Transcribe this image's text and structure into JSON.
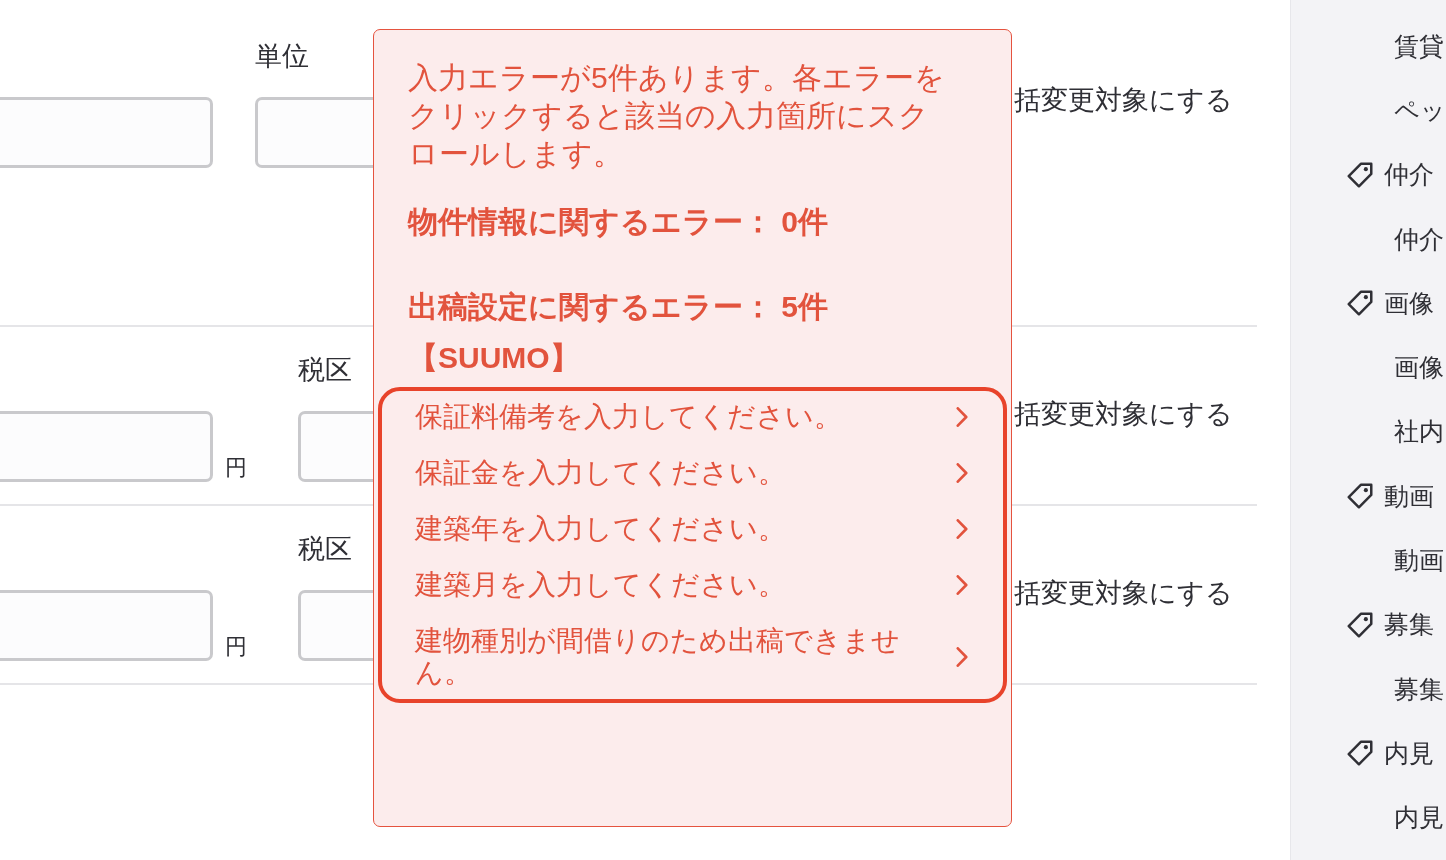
{
  "form": {
    "rows": [
      {
        "field_label": "単位",
        "bulk_label": "括変更対象にする"
      },
      {
        "unit": "円",
        "field_label": "税区",
        "bulk_label": "括変更対象にする"
      },
      {
        "unit": "円",
        "field_label": "税区",
        "bulk_label": "括変更対象にする"
      }
    ]
  },
  "error_popup": {
    "message": "入力エラーが5件あります。各エラーをクリックすると該当の入力箇所にスクロールします。",
    "counts": [
      "物件情報に関するエラー： 0件",
      "出稿設定に関するエラー： 5件"
    ],
    "site": "【SUUMO】",
    "errors": [
      "保証料備考を入力してください。",
      "保証金を入力してください。",
      "建築年を入力してください。",
      "建築月を入力してください。",
      "建物種別が間借りのため出稿できません。"
    ]
  },
  "sidebar": {
    "groups": [
      {
        "children": [
          "賃貸",
          "ペッ"
        ]
      },
      {
        "label": "仲介",
        "children": [
          "仲介"
        ]
      },
      {
        "label": "画像",
        "children": [
          "画像",
          "社内"
        ]
      },
      {
        "label": "動画",
        "children": [
          "動画"
        ]
      },
      {
        "label": "募集",
        "children": [
          "募集"
        ]
      },
      {
        "label": "内見",
        "children": [
          "内見"
        ]
      }
    ]
  }
}
